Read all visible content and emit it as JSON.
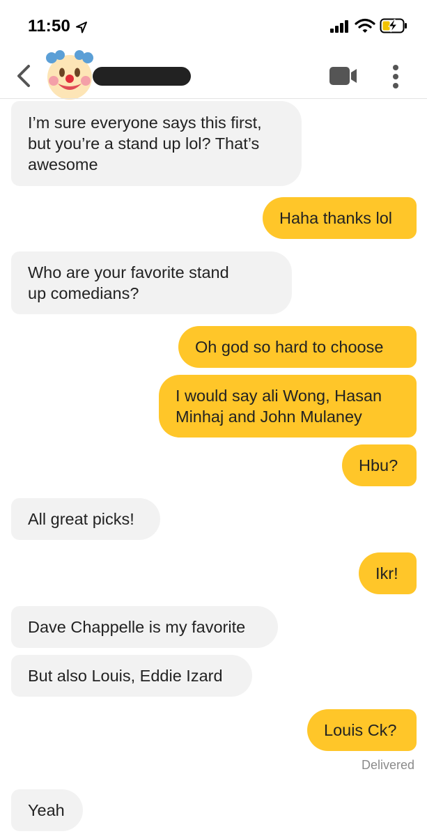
{
  "status_bar": {
    "time": "11:50"
  },
  "header": {
    "avatar_icon": "clown-face-emoji",
    "video_icon": "video-camera-icon",
    "menu_icon": "vertical-ellipsis-icon"
  },
  "messages": [
    {
      "side": "in",
      "text": "I’m sure everyone says this first,\nbut you’re a stand up lol? That’s\nawesome"
    },
    {
      "side": "out",
      "text": "Haha thanks lol"
    },
    {
      "side": "in",
      "text": "Who are your favorite stand\nup comedians?"
    },
    {
      "side": "out",
      "text": "Oh god so hard to choose"
    },
    {
      "side": "out",
      "text": "I would say ali Wong, Hasan\nMinhaj and John Mulaney"
    },
    {
      "side": "out",
      "text": "Hbu?"
    },
    {
      "side": "in",
      "text": "All great picks!"
    },
    {
      "side": "out",
      "text": "Ikr!"
    },
    {
      "side": "in",
      "text": "Dave Chappelle is my favorite"
    },
    {
      "side": "in",
      "text": "But also Louis, Eddie Izard"
    },
    {
      "side": "out",
      "text": "Louis Ck?"
    },
    {
      "side": "in",
      "text": "Yeah"
    }
  ],
  "delivered_label": "Delivered",
  "colors": {
    "outgoing_bubble": "#ffc629",
    "incoming_bubble": "#f2f2f2"
  }
}
